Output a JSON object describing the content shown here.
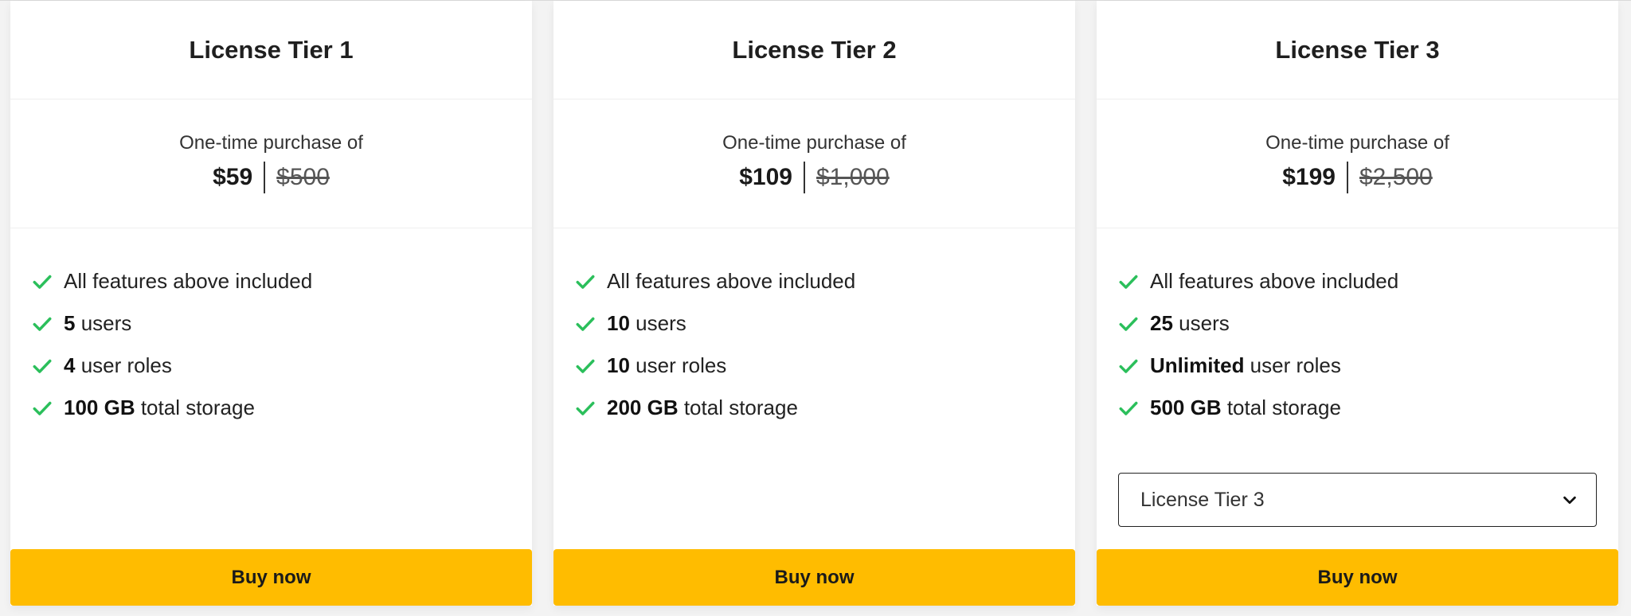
{
  "colors": {
    "accent": "#ffbc00",
    "check": "#2bbf5b",
    "card_background": "#ffffff",
    "page_background": "#f3f3f3"
  },
  "icons": {
    "feature_icon": "check-icon",
    "select_icon": "chevron-down-icon"
  },
  "tiers": [
    {
      "title": "License Tier 1",
      "price_caption": "One-time purchase of",
      "price": "$59",
      "original_price": "$500",
      "features": [
        {
          "bold": "",
          "text": "All features above included"
        },
        {
          "bold": "5",
          "text": " users"
        },
        {
          "bold": "4",
          "text": " user roles"
        },
        {
          "bold": "100 GB",
          "text": " total storage"
        }
      ],
      "buy_label": "Buy now"
    },
    {
      "title": "License Tier 2",
      "price_caption": "One-time purchase of",
      "price": "$109",
      "original_price": "$1,000",
      "features": [
        {
          "bold": "",
          "text": "All features above included"
        },
        {
          "bold": "10",
          "text": " users"
        },
        {
          "bold": "10",
          "text": " user roles"
        },
        {
          "bold": "200 GB",
          "text": " total storage"
        }
      ],
      "buy_label": "Buy now"
    },
    {
      "title": "License Tier 3",
      "price_caption": "One-time purchase of",
      "price": "$199",
      "original_price": "$2,500",
      "features": [
        {
          "bold": "",
          "text": "All features above included"
        },
        {
          "bold": "25",
          "text": " users"
        },
        {
          "bold": "Unlimited",
          "text": " user roles"
        },
        {
          "bold": "500 GB",
          "text": " total storage"
        }
      ],
      "select": {
        "value": "License Tier 3"
      },
      "buy_label": "Buy now"
    }
  ]
}
